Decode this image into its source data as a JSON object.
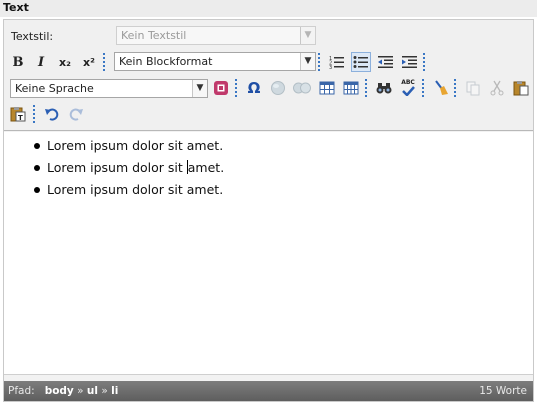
{
  "panel": {
    "title": "Text"
  },
  "toolbar": {
    "textstyle_label": "Textstil:",
    "textstyle_value": "Kein Textstil",
    "blockformat_value": "Kein Blockformat",
    "language_value": "Keine Sprache",
    "bold": "B",
    "italic": "I",
    "subscript": "x₂",
    "superscript": "x²",
    "omega": "Ω",
    "spell": "ABC"
  },
  "content": {
    "items": [
      {
        "before": "Lorem ipsum dolor sit amet.",
        "after": ""
      },
      {
        "before": "Lorem ipsum dolor sit ",
        "after": "amet."
      },
      {
        "before": "Lorem ipsum dolor sit amet.",
        "after": ""
      }
    ]
  },
  "status": {
    "path_label": "Pfad:",
    "path": [
      "body",
      "ul",
      "li"
    ],
    "separator": "»",
    "word_count": "15 Worte"
  }
}
